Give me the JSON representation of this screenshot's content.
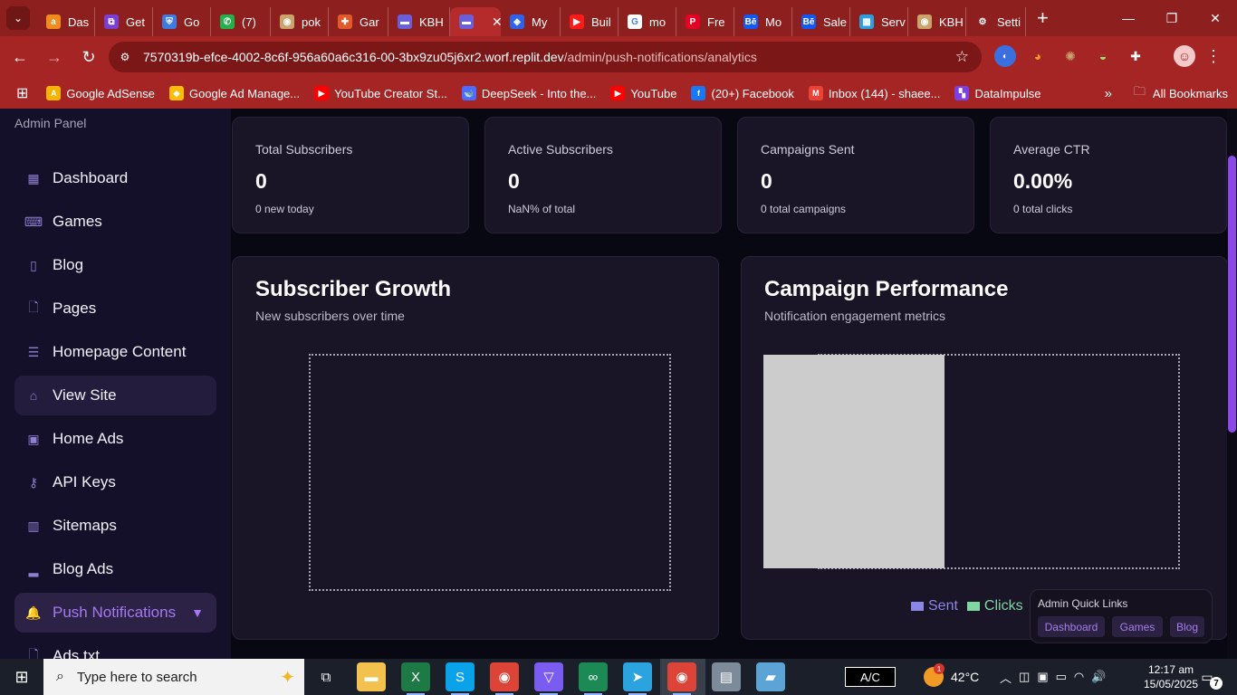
{
  "browser": {
    "tabs": [
      {
        "title": "Das",
        "icon": "amazon-icon",
        "color": "#f08b1d",
        "glyph": "a"
      },
      {
        "title": "Get",
        "icon": "app-icon",
        "color": "#7a3fd1",
        "glyph": "⧉"
      },
      {
        "title": "Go",
        "icon": "shield-icon",
        "color": "#3d7be0",
        "glyph": "⛨"
      },
      {
        "title": "(7)",
        "icon": "whatsapp-icon",
        "color": "#25b04a",
        "glyph": "✆"
      },
      {
        "title": "pok",
        "icon": "game-icon",
        "color": "#c9a46b",
        "glyph": "◉"
      },
      {
        "title": "Gar",
        "icon": "puzzle-icon",
        "color": "#e35a2a",
        "glyph": "✚"
      },
      {
        "title": "KBH",
        "icon": "gamepad-icon",
        "color": "#6a5fd8",
        "glyph": "▬"
      },
      {
        "title": "",
        "icon": "gamepad-icon",
        "color": "#6a5fd8",
        "glyph": "▬",
        "active": true
      },
      {
        "title": "My",
        "icon": "link-icon",
        "color": "#2e63e8",
        "glyph": "◈"
      },
      {
        "title": "Buil",
        "icon": "youtube-icon",
        "color": "#ff1a1a",
        "glyph": "▶"
      },
      {
        "title": "mo",
        "icon": "google-icon",
        "color": "#ffffff",
        "glyph": "G"
      },
      {
        "title": "Fre",
        "icon": "pinterest-icon",
        "color": "#e60023",
        "glyph": "P"
      },
      {
        "title": "Mo",
        "icon": "behance-icon",
        "color": "#1458f5",
        "glyph": "Bē"
      },
      {
        "title": "Sale",
        "icon": "behance-icon",
        "color": "#1458f5",
        "glyph": "Bē"
      },
      {
        "title": "Serv",
        "icon": "grid-icon",
        "color": "#2aa0e0",
        "glyph": "▦"
      },
      {
        "title": "KBH",
        "icon": "game-icon",
        "color": "#c9a46b",
        "glyph": "◉"
      },
      {
        "title": "Setti",
        "icon": "gear-icon",
        "color": "transparent",
        "glyph": "⚙"
      }
    ],
    "new_tab": "+",
    "url_host": "7570319b-efce-4002-8c6f-956a60a6c316-00-3bx9zu05j6xr2.worf.replit.dev",
    "url_path": "/admin/push-notifications/analytics",
    "bookmarks": [
      {
        "label": "Google AdSense",
        "color": "#f4b400",
        "glyph": "A"
      },
      {
        "label": "Google Ad Manage...",
        "color": "#fbbc04",
        "glyph": "◆"
      },
      {
        "label": "YouTube Creator St...",
        "color": "#ff0000",
        "glyph": "▶"
      },
      {
        "label": "DeepSeek - Into the...",
        "color": "#4d6bfe",
        "glyph": "🐋"
      },
      {
        "label": "YouTube",
        "color": "#ff0000",
        "glyph": "▶"
      },
      {
        "label": "(20+) Facebook",
        "color": "#1877f2",
        "glyph": "f"
      },
      {
        "label": "Inbox (144) - shaee...",
        "color": "#ea4335",
        "glyph": "M"
      },
      {
        "label": "DataImpulse",
        "color": "#7b3fe4",
        "glyph": "▚"
      }
    ],
    "all_bookmarks": "All Bookmarks"
  },
  "sidebar": {
    "title": "Admin Panel",
    "items": [
      {
        "label": "Dashboard",
        "icon": "dashboard-icon",
        "glyph": "▦"
      },
      {
        "label": "Games",
        "icon": "gamepad-icon",
        "glyph": "⌨"
      },
      {
        "label": "Blog",
        "icon": "book-icon",
        "glyph": "▯"
      },
      {
        "label": "Pages",
        "icon": "file-icon",
        "glyph": "🗋"
      },
      {
        "label": "Homepage Content",
        "icon": "document-icon",
        "glyph": "☰"
      },
      {
        "label": "View Site",
        "icon": "home-icon",
        "glyph": "⌂"
      },
      {
        "label": "Home Ads",
        "icon": "image-icon",
        "glyph": "▣"
      },
      {
        "label": "API Keys",
        "icon": "key-icon",
        "glyph": "⚷"
      },
      {
        "label": "Sitemaps",
        "icon": "map-icon",
        "glyph": "▥"
      },
      {
        "label": "Blog Ads",
        "icon": "bar-chart-icon",
        "glyph": "▂"
      },
      {
        "label": "Push Notifications",
        "icon": "bell-icon",
        "glyph": "🔔"
      },
      {
        "label": "Ads.txt",
        "icon": "file-icon",
        "glyph": "🗋"
      }
    ],
    "expand_caret": "▼"
  },
  "stats": [
    {
      "label": "Total Subscribers",
      "value": "0",
      "sub": "0 new today"
    },
    {
      "label": "Active Subscribers",
      "value": "0",
      "sub": "NaN% of total"
    },
    {
      "label": "Campaigns Sent",
      "value": "0",
      "sub": "0 total campaigns"
    },
    {
      "label": "Average CTR",
      "value": "0.00%",
      "sub": "0 total clicks"
    }
  ],
  "growth": {
    "title": "Subscriber Growth",
    "subtitle": "New subscribers over time"
  },
  "performance": {
    "title": "Campaign Performance",
    "subtitle": "Notification engagement metrics",
    "legend": [
      {
        "label": "Sent",
        "color": "#8a86e6"
      },
      {
        "label": "Clicks",
        "color": "#7fd6a0"
      }
    ]
  },
  "quick_links": {
    "title": "Admin Quick Links",
    "links": [
      "Dashboard",
      "Games",
      "Blog"
    ]
  },
  "taskbar": {
    "search_placeholder": "Type here to search",
    "ac_label": "A/C",
    "temperature": "42°C",
    "weather_badge": "1",
    "time": "12:17 am",
    "date": "15/05/2025",
    "notif_count": "7",
    "apps": [
      {
        "icon": "task-view-icon",
        "glyph": "⧉",
        "color": "transparent"
      },
      {
        "icon": "file-explorer-icon",
        "glyph": "▬",
        "color": "#f2c14e"
      },
      {
        "icon": "excel-icon",
        "glyph": "X",
        "color": "#1d7a45"
      },
      {
        "icon": "skype-icon",
        "glyph": "S",
        "color": "#0aa2e8"
      },
      {
        "icon": "chrome-icon",
        "glyph": "◉",
        "color": "#db4437"
      },
      {
        "icon": "vpn-icon",
        "glyph": "▽",
        "color": "#7a5cf0"
      },
      {
        "icon": "app-green-icon",
        "glyph": "∞",
        "color": "#1c8a54"
      },
      {
        "icon": "telegram-icon",
        "glyph": "➤",
        "color": "#2aa3df"
      },
      {
        "icon": "chrome-active-icon",
        "glyph": "◉",
        "color": "#db4437"
      },
      {
        "icon": "photos-icon",
        "glyph": "▤",
        "color": "#7d8a9a"
      },
      {
        "icon": "notes-icon",
        "glyph": "▰",
        "color": "#5da4d6"
      }
    ]
  }
}
